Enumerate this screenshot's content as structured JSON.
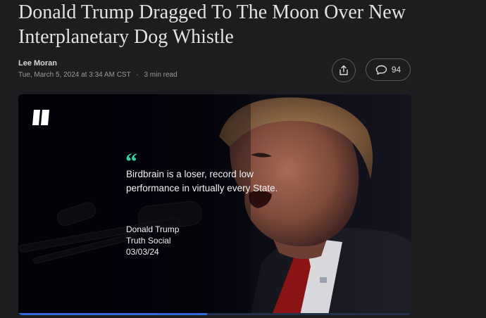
{
  "article": {
    "headline": "Donald Trump Dragged To The Moon Over New Interplanetary Dog Whistle",
    "author": "Lee Moran",
    "date": "Tue, March 5, 2024 at 3:34 AM CST",
    "read_time": "3 min read",
    "separator": "·"
  },
  "actions": {
    "share_icon": "share-icon",
    "comment_icon": "comment-icon",
    "comment_count": "94"
  },
  "hero": {
    "logo_icon": "huffpost-logo",
    "quote_icon": "quote-icon",
    "quote_mark": "“",
    "quote": "Birdbrain is a loser, record low performance in virtually every State.",
    "attribution": {
      "name": "Donald Trump",
      "source": "Truth Social",
      "date": "03/03/24"
    },
    "accent_color": "#2fd0a6",
    "progress_fraction": 0.48
  },
  "colors": {
    "background": "#1d1d1f",
    "progress": "#2f6bdb"
  }
}
